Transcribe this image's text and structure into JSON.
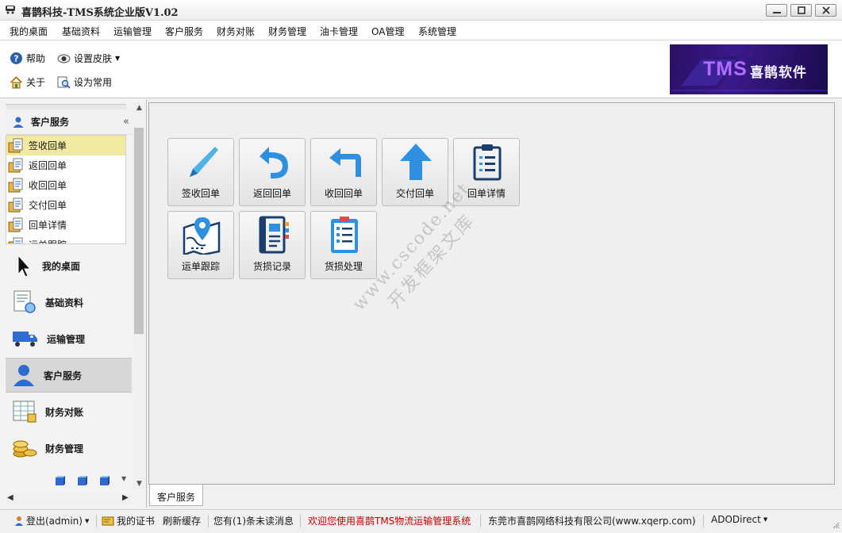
{
  "window": {
    "title": "喜鹊科技-TMS系统企业版V1.02"
  },
  "menu": [
    "我的桌面",
    "基础资料",
    "运输管理",
    "客户服务",
    "财务对账",
    "财务管理",
    "油卡管理",
    "OA管理",
    "系统管理"
  ],
  "toolbar": {
    "help": "帮助",
    "skin": "设置皮肤",
    "about": "关于",
    "favorite": "设为常用"
  },
  "banner": {
    "tms": "TMS",
    "name": "喜鹊软件"
  },
  "leftpanel": {
    "section_title": "客户服务",
    "items": [
      "签收回单",
      "返回回单",
      "收回回单",
      "交付回单",
      "回单详情",
      "运单跟踪"
    ],
    "selected_index": 0,
    "groups": [
      "我的桌面",
      "基础资料",
      "运输管理",
      "客户服务",
      "财务对账",
      "财务管理"
    ],
    "active_group": "客户服务"
  },
  "modules": [
    {
      "label": "签收回单",
      "icon": "pen-icon"
    },
    {
      "label": "返回回单",
      "icon": "undo-arrow-icon"
    },
    {
      "label": "收回回单",
      "icon": "return-arrow-icon"
    },
    {
      "label": "交付回单",
      "icon": "up-arrow-icon"
    },
    {
      "label": "回单详情",
      "icon": "clipboard-icon"
    },
    {
      "label": "运单跟踪",
      "icon": "map-pin-icon"
    },
    {
      "label": "货损记录",
      "icon": "notebook-icon"
    },
    {
      "label": "货损处理",
      "icon": "checklist-icon"
    }
  ],
  "watermark": {
    "line1": "www.cscode.net",
    "line2": "开发框架文库"
  },
  "doc_tab": "客户服务",
  "status": {
    "logout": "登出(admin)",
    "cert": "我的证书",
    "refresh": "刷新缓存",
    "messages": "您有(1)条未读消息",
    "welcome": "欢迎您使用喜鹊TMS物流运输管理系统",
    "company": "东莞市喜鹊网络科技有限公司(www.xqerp.com)",
    "db": "ADODirect",
    "welcome_color": "#c00000"
  }
}
